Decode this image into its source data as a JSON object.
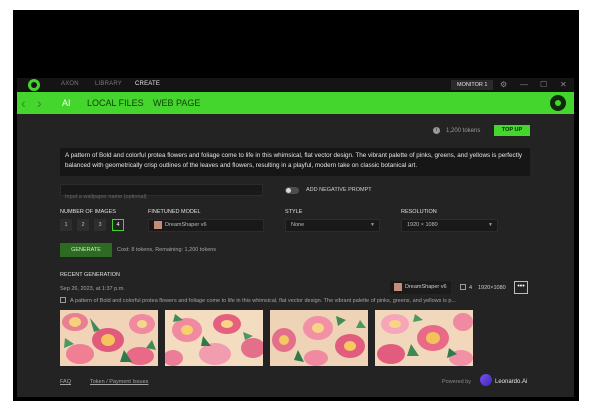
{
  "titlebar": {
    "nav": [
      "AXON",
      "LIBRARY",
      "CREATE"
    ],
    "active_nav": "CREATE",
    "monitor_label": "MONITOR 1",
    "window_buttons": [
      "⚙",
      "—",
      "☐",
      "✕"
    ]
  },
  "tabs": {
    "items": [
      "AI",
      "LOCAL FILES",
      "WEB PAGE"
    ],
    "active": "AI"
  },
  "tokens": {
    "count_label": "1,200 tokens",
    "topup_label": "TOP UP"
  },
  "prompt": {
    "text": "A pattern of Bold and colorful protea flowers and foliage come to life in this whimsical, flat vector design. The vibrant palette of pinks, greens, and yellows is perfectly balanced with geometrically crisp outlines of the leaves and flowers, resulting in a playful, modern take on classic botanical art."
  },
  "negative": {
    "placeholder": "Input a wallpaper name (optional)",
    "toggle_label": "ADD NEGATIVE PROMPT"
  },
  "settings": {
    "num_images_label": "NUMBER OF IMAGES",
    "num_options": [
      "1",
      "2",
      "3",
      "4"
    ],
    "num_selected": "4",
    "model_label": "FINETUNED MODEL",
    "model_value": "DreamShaper v6",
    "style_label": "STYLE",
    "style_value": "None",
    "resolution_label": "RESOLUTION",
    "resolution_value": "1920 × 1080"
  },
  "generate": {
    "button_label": "GENERATE",
    "cost_text": "Cost: 8 tokens, Remaining: 1,200 tokens"
  },
  "recent": {
    "title": "RECENT GENERATION",
    "date": "Sep 26, 2023, at 1:37 p.m.",
    "model": "DreamShaper v6",
    "image_count": "4",
    "resolution": "1920×1080",
    "more_label": "•••",
    "prompt": "A pattern of Bold and colorful protea flowers and foliage come to life in this whimsical, flat vector design. The vibrant palette of pinks, greens, and yellows is p..."
  },
  "footer": {
    "faq": "FAQ",
    "token_issues": "Token / Payment Issues",
    "powered_by": "Powered by",
    "brand": "Leonardo.Ai"
  },
  "colors": {
    "accent": "#44d62c",
    "background": "#232323",
    "titlebar": "#141414"
  }
}
